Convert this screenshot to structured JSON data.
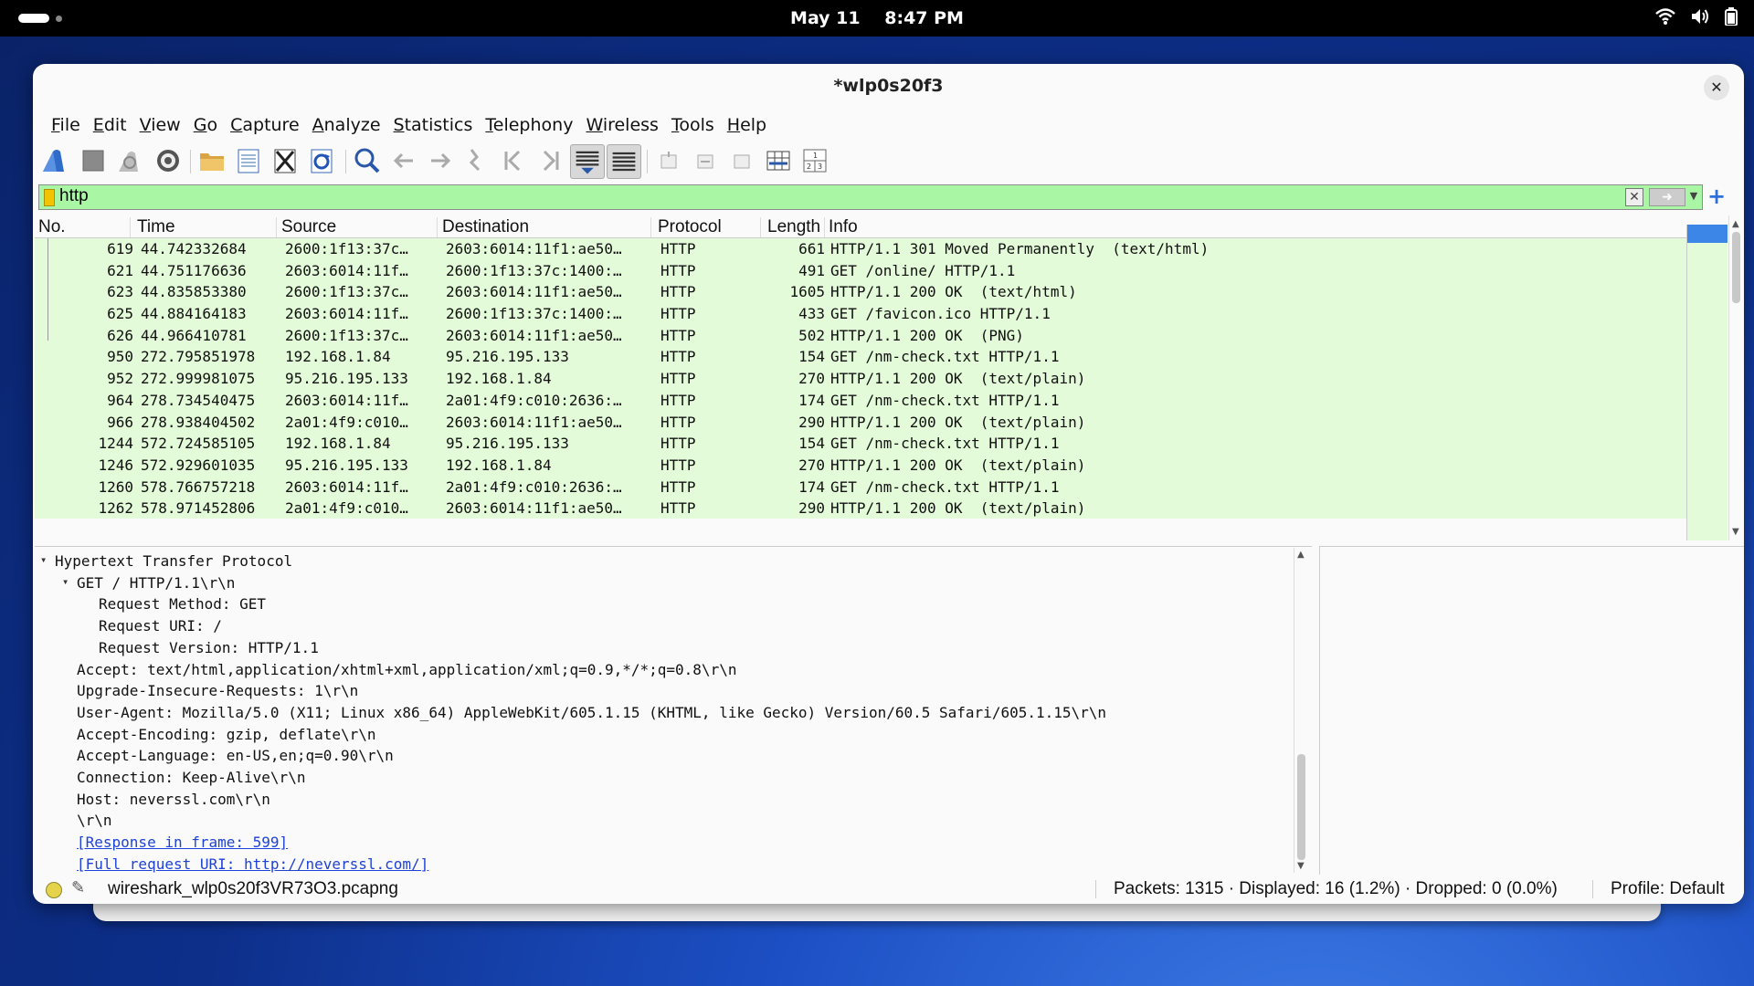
{
  "system": {
    "date": "May 11",
    "time": "8:47 PM",
    "tray_icons": [
      "wifi-icon",
      "volume-icon",
      "battery-icon"
    ]
  },
  "window": {
    "title": "*wlp0s20f3"
  },
  "menu": [
    "File",
    "Edit",
    "View",
    "Go",
    "Capture",
    "Analyze",
    "Statistics",
    "Telephony",
    "Wireless",
    "Tools",
    "Help"
  ],
  "toolbar": {
    "icons": [
      "start-capture-icon",
      "stop-capture-icon",
      "restart-capture-icon",
      "capture-options-icon",
      "open-file-icon",
      "save-file-icon",
      "close-file-icon",
      "reload-file-icon",
      "find-packet-icon",
      "go-back-icon",
      "go-forward-icon",
      "go-to-packet-icon",
      "first-packet-icon",
      "last-packet-icon",
      "autoscroll-icon",
      "colorize-icon",
      "zoom-in-icon",
      "zoom-out-icon",
      "normal-size-icon",
      "resize-columns-icon",
      "layout-icon"
    ]
  },
  "filter": {
    "value": "http",
    "color": "#a9f6a5"
  },
  "packet_list": {
    "columns": [
      "No.",
      "Time",
      "Source",
      "Destination",
      "Protocol",
      "Length",
      "Info"
    ],
    "rows": [
      {
        "no": "619",
        "time": "44.742332684",
        "src": "2600:1f13:37c…",
        "dst": "2603:6014:11f1:ae50…",
        "proto": "HTTP",
        "len": "661",
        "info": "HTTP/1.1 301 Moved Permanently  (text/html)"
      },
      {
        "no": "621",
        "time": "44.751176636",
        "src": "2603:6014:11f…",
        "dst": "2600:1f13:37c:1400:…",
        "proto": "HTTP",
        "len": "491",
        "info": "GET /online/ HTTP/1.1"
      },
      {
        "no": "623",
        "time": "44.835853380",
        "src": "2600:1f13:37c…",
        "dst": "2603:6014:11f1:ae50…",
        "proto": "HTTP",
        "len": "1605",
        "info": "HTTP/1.1 200 OK  (text/html)"
      },
      {
        "no": "625",
        "time": "44.884164183",
        "src": "2603:6014:11f…",
        "dst": "2600:1f13:37c:1400:…",
        "proto": "HTTP",
        "len": "433",
        "info": "GET /favicon.ico HTTP/1.1"
      },
      {
        "no": "626",
        "time": "44.966410781",
        "src": "2600:1f13:37c…",
        "dst": "2603:6014:11f1:ae50…",
        "proto": "HTTP",
        "len": "502",
        "info": "HTTP/1.1 200 OK  (PNG)"
      },
      {
        "no": "950",
        "time": "272.795851978",
        "src": "192.168.1.84",
        "dst": "95.216.195.133",
        "proto": "HTTP",
        "len": "154",
        "info": "GET /nm-check.txt HTTP/1.1"
      },
      {
        "no": "952",
        "time": "272.999981075",
        "src": "95.216.195.133",
        "dst": "192.168.1.84",
        "proto": "HTTP",
        "len": "270",
        "info": "HTTP/1.1 200 OK  (text/plain)"
      },
      {
        "no": "964",
        "time": "278.734540475",
        "src": "2603:6014:11f…",
        "dst": "2a01:4f9:c010:2636:…",
        "proto": "HTTP",
        "len": "174",
        "info": "GET /nm-check.txt HTTP/1.1"
      },
      {
        "no": "966",
        "time": "278.938404502",
        "src": "2a01:4f9:c010…",
        "dst": "2603:6014:11f1:ae50…",
        "proto": "HTTP",
        "len": "290",
        "info": "HTTP/1.1 200 OK  (text/plain)"
      },
      {
        "no": "1244",
        "time": "572.724585105",
        "src": "192.168.1.84",
        "dst": "95.216.195.133",
        "proto": "HTTP",
        "len": "154",
        "info": "GET /nm-check.txt HTTP/1.1"
      },
      {
        "no": "1246",
        "time": "572.929601035",
        "src": "95.216.195.133",
        "dst": "192.168.1.84",
        "proto": "HTTP",
        "len": "270",
        "info": "HTTP/1.1 200 OK  (text/plain)"
      },
      {
        "no": "1260",
        "time": "578.766757218",
        "src": "2603:6014:11f…",
        "dst": "2a01:4f9:c010:2636:…",
        "proto": "HTTP",
        "len": "174",
        "info": "GET /nm-check.txt HTTP/1.1"
      },
      {
        "no": "1262",
        "time": "578.971452806",
        "src": "2a01:4f9:c010…",
        "dst": "2603:6014:11f1:ae50…",
        "proto": "HTTP",
        "len": "290",
        "info": "HTTP/1.1 200 OK  (text/plain)"
      }
    ],
    "row_color": "#e4fbd9"
  },
  "details": {
    "lines": [
      {
        "indent": 0,
        "toggle": "expanded",
        "text": "Hypertext Transfer Protocol"
      },
      {
        "indent": 1,
        "toggle": "expanded",
        "text": "GET / HTTP/1.1\\r\\n"
      },
      {
        "indent": 2,
        "toggle": "",
        "text": "Request Method: GET"
      },
      {
        "indent": 2,
        "toggle": "",
        "text": "Request URI: /"
      },
      {
        "indent": 2,
        "toggle": "",
        "text": "Request Version: HTTP/1.1"
      },
      {
        "indent": 1,
        "toggle": "",
        "text": "Accept: text/html,application/xhtml+xml,application/xml;q=0.9,*/*;q=0.8\\r\\n"
      },
      {
        "indent": 1,
        "toggle": "",
        "text": "Upgrade-Insecure-Requests: 1\\r\\n"
      },
      {
        "indent": 1,
        "toggle": "",
        "text": "User-Agent: Mozilla/5.0 (X11; Linux x86_64) AppleWebKit/605.1.15 (KHTML, like Gecko) Version/60.5 Safari/605.1.15\\r\\n"
      },
      {
        "indent": 1,
        "toggle": "",
        "text": "Accept-Encoding: gzip, deflate\\r\\n"
      },
      {
        "indent": 1,
        "toggle": "",
        "text": "Accept-Language: en-US,en;q=0.90\\r\\n"
      },
      {
        "indent": 1,
        "toggle": "",
        "text": "Connection: Keep-Alive\\r\\n"
      },
      {
        "indent": 1,
        "toggle": "",
        "text": "Host: neverssl.com\\r\\n"
      },
      {
        "indent": 1,
        "toggle": "",
        "text": "\\r\\n"
      },
      {
        "indent": 1,
        "toggle": "",
        "link": true,
        "text": "[Response in frame: 599]"
      },
      {
        "indent": 1,
        "toggle": "",
        "link": true,
        "text": "[Full request URI: http://neverssl.com/]"
      }
    ]
  },
  "status": {
    "file": "wireshark_wlp0s20f3VR73O3.pcapng",
    "stats": "Packets: 1315 · Displayed: 16 (1.2%) · Dropped: 0 (0.0%)",
    "profile": "Profile: Default"
  }
}
